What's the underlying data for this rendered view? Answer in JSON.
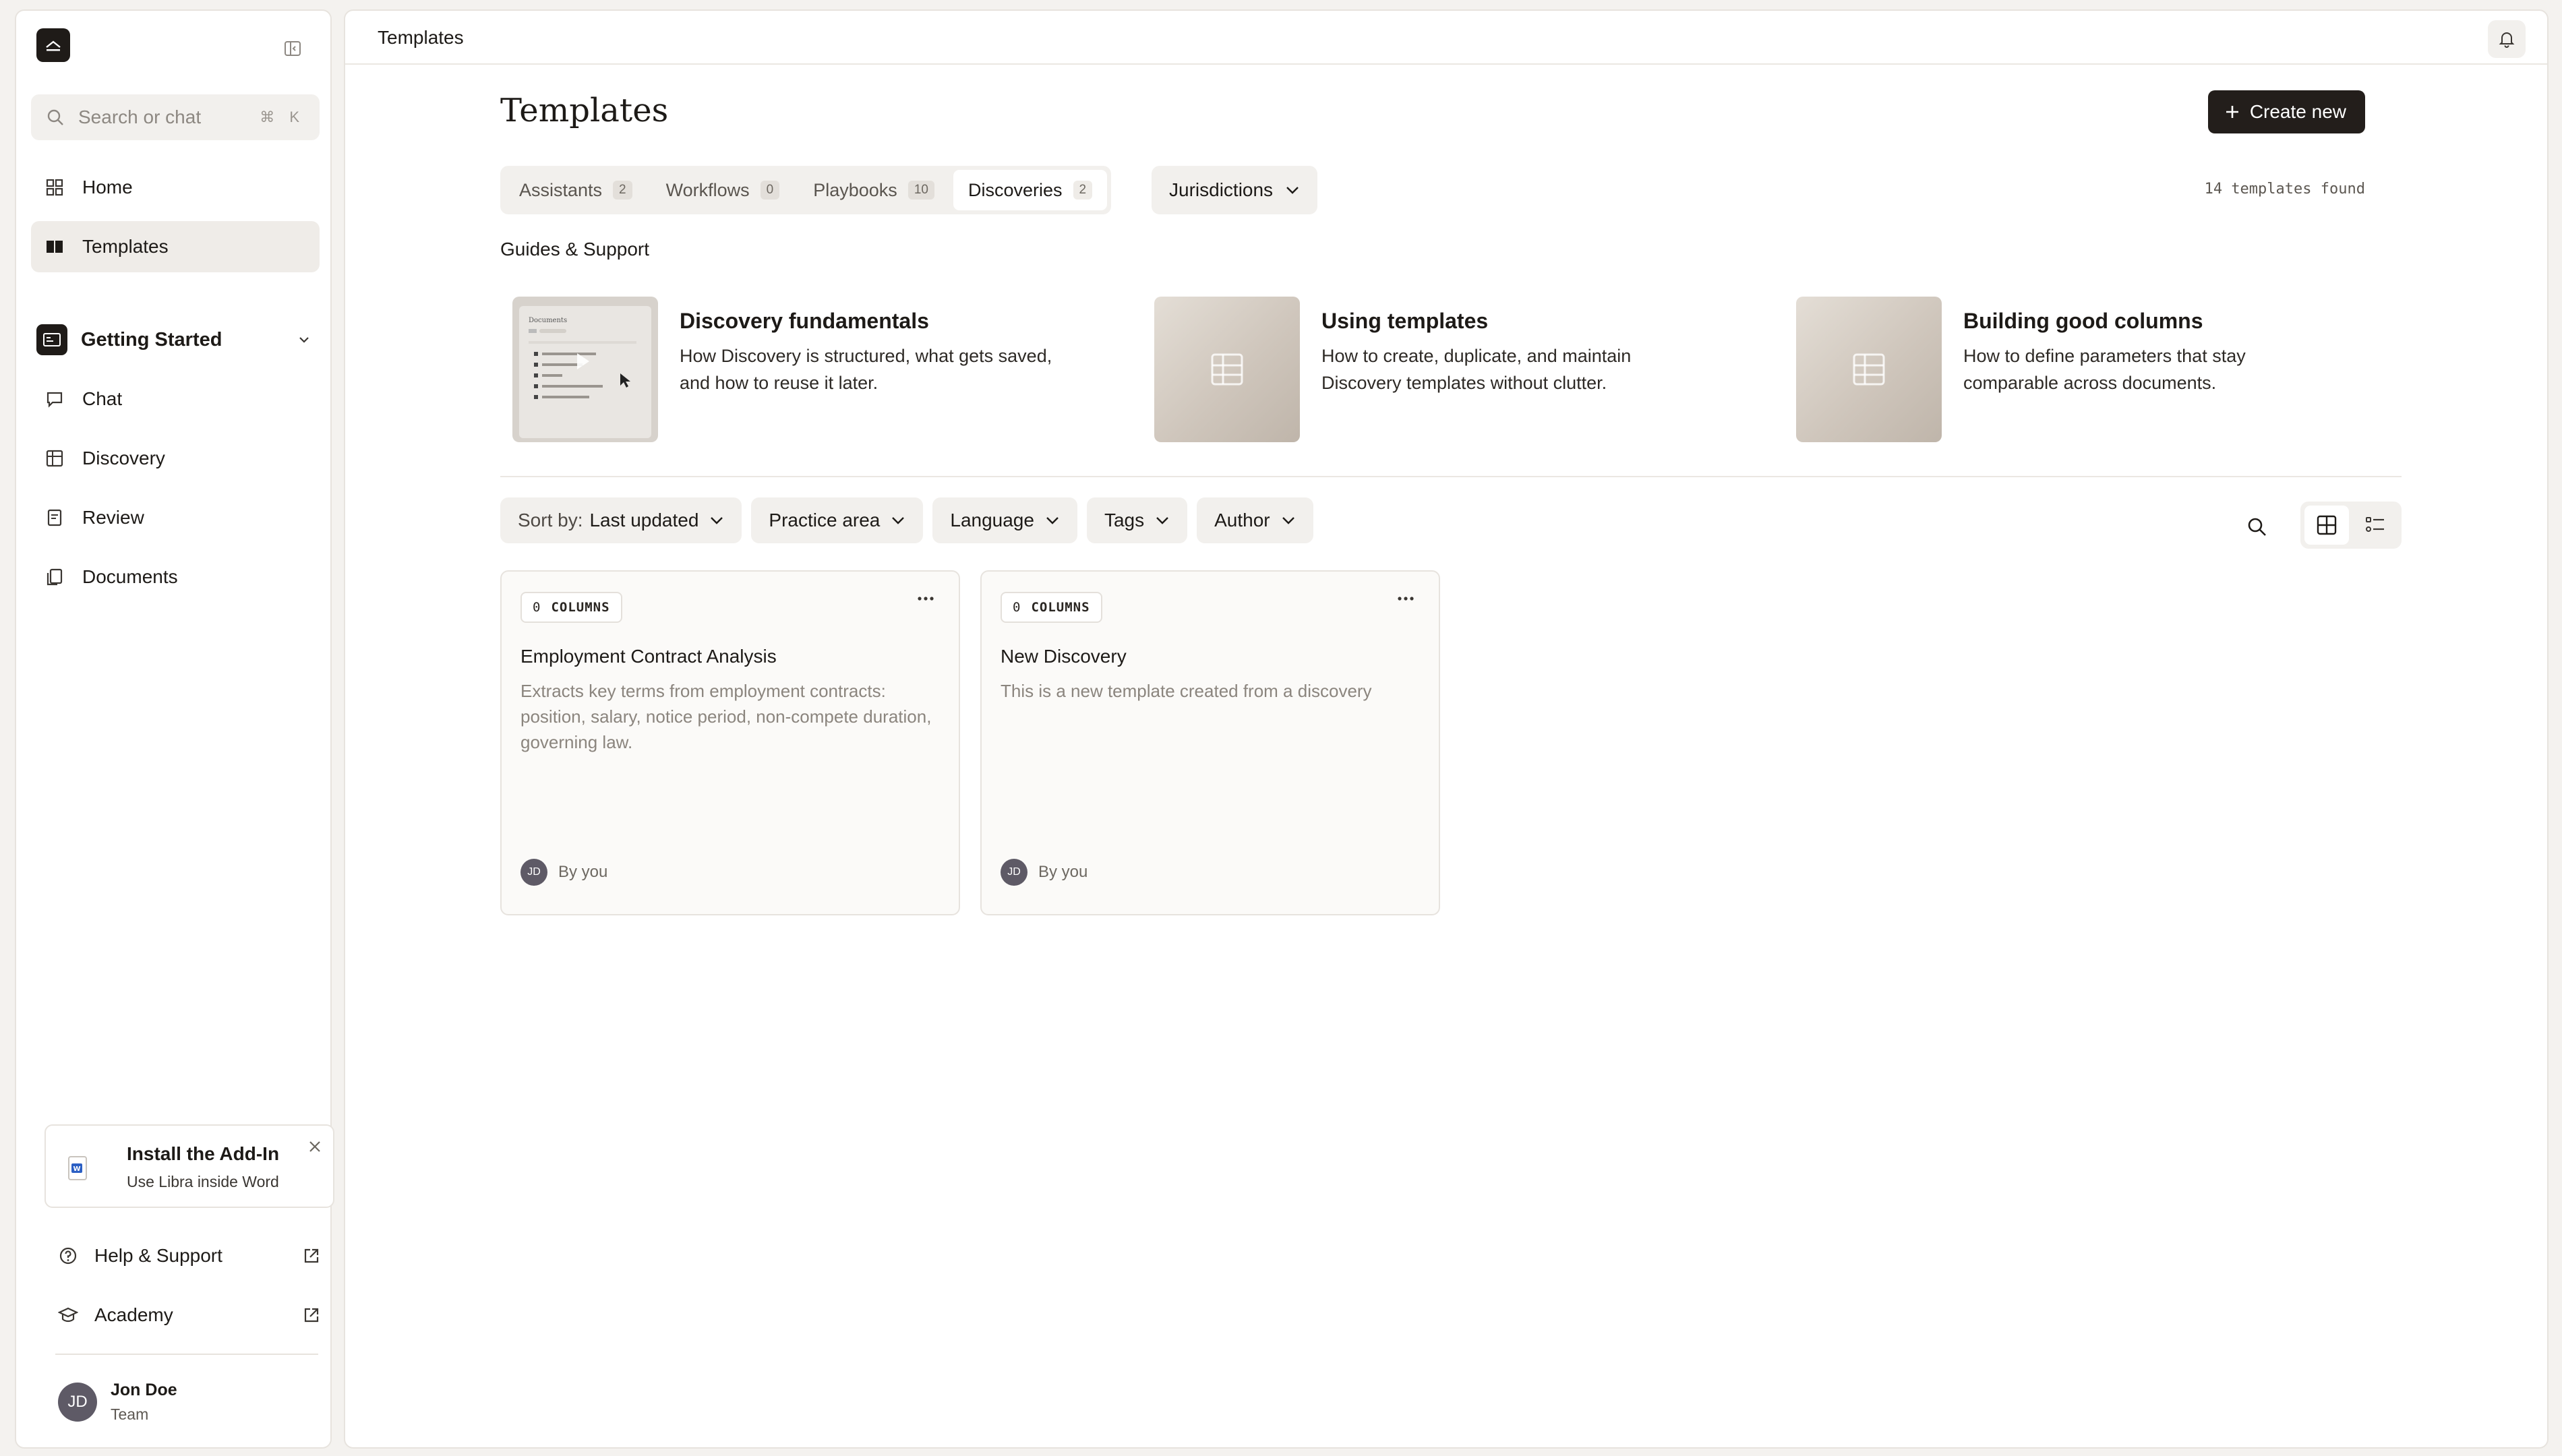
{
  "sidebar": {
    "search": {
      "placeholder": "Search or chat",
      "shortcut": "⌘ K"
    },
    "nav": [
      {
        "label": "Home",
        "icon": "home-icon"
      },
      {
        "label": "Templates",
        "icon": "book-icon",
        "active": true
      }
    ],
    "section": {
      "label": "Getting Started",
      "icon": "getting-started-icon"
    },
    "section_items": [
      {
        "label": "Chat",
        "icon": "chat-icon"
      },
      {
        "label": "Discovery",
        "icon": "table-icon"
      },
      {
        "label": "Review",
        "icon": "review-icon"
      },
      {
        "label": "Documents",
        "icon": "documents-icon"
      }
    ],
    "addin": {
      "title": "Install the Add-In",
      "subtitle": "Use Libra inside Word"
    },
    "footer": [
      {
        "label": "Help & Support",
        "icon": "help-icon"
      },
      {
        "label": "Academy",
        "icon": "academy-icon"
      }
    ],
    "user": {
      "initials": "JD",
      "name": "Jon Doe",
      "team": "Team"
    }
  },
  "topbar": {
    "title": "Templates"
  },
  "page": {
    "title": "Templates",
    "create_label": "Create new",
    "tabs": [
      {
        "label": "Assistants",
        "count": "2"
      },
      {
        "label": "Workflows",
        "count": "0"
      },
      {
        "label": "Playbooks",
        "count": "10"
      },
      {
        "label": "Discoveries",
        "count": "2",
        "active": true
      }
    ],
    "jurisdictions_label": "Jurisdictions",
    "found_text": "14 templates found",
    "guides_label": "Guides & Support",
    "guides": [
      {
        "title": "Discovery fundamentals",
        "desc": "How Discovery is structured, what gets saved, and how to reuse it later."
      },
      {
        "title": "Using templates",
        "desc": "How to create, duplicate, and maintain Discovery templates without clutter."
      },
      {
        "title": "Building good columns",
        "desc": "How to define parameters that stay comparable across documents."
      }
    ],
    "filters": {
      "sort_prefix": "Sort by:",
      "sort_value": "Last updated",
      "practice_area": "Practice area",
      "language": "Language",
      "tags": "Tags",
      "author": "Author"
    },
    "cards": [
      {
        "columns_count": "0",
        "columns_label": "COLUMNS",
        "title": "Employment Contract Analysis",
        "desc": "Extracts key terms from employment contracts: position, salary, notice period, non-compete duration, governing law.",
        "author_initials": "JD",
        "author": "By you"
      },
      {
        "columns_count": "0",
        "columns_label": "COLUMNS",
        "title": "New Discovery",
        "desc": "This is a new template created from a discovery",
        "author_initials": "JD",
        "author": "By you"
      }
    ]
  },
  "colors": {
    "accent_dark": "#231e1b",
    "surface": "#f2f0ed",
    "border": "#e7e3de",
    "avatar": "#5e5a66"
  }
}
